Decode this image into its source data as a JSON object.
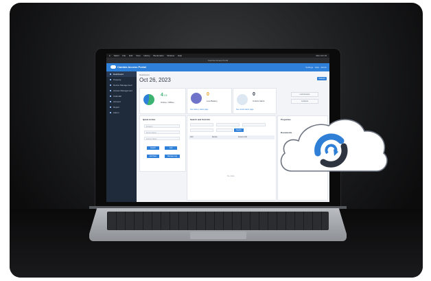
{
  "menubar": {
    "items": [
      "Safari",
      "File",
      "Edit",
      "View",
      "History",
      "Bookmarks",
      "Window",
      "Help"
    ],
    "right": "Mon Oct 16"
  },
  "window": {
    "title": "Cambia Access Portal"
  },
  "app": {
    "brand": "Cambia Access Portal",
    "header_tools": [
      "Settings",
      "Help",
      "Admin"
    ],
    "nav": [
      {
        "label": "Dashboard",
        "active": true
      },
      {
        "label": "Property"
      },
      {
        "label": "Device Management"
      },
      {
        "label": "Access Management"
      },
      {
        "label": "Calendar"
      },
      {
        "label": "Account"
      },
      {
        "label": "Report"
      },
      {
        "label": "Admin"
      }
    ]
  },
  "dashboard": {
    "breadcrumb": "Dashboard",
    "date": "Oct 26, 2023",
    "action_label": "Refresh",
    "stats": [
      {
        "value": "4",
        "secondary": "0",
        "label": "Online / Offline",
        "color": "#3cb371"
      },
      {
        "value": "0",
        "label": "Low Battery",
        "color": "#f0a020",
        "link": "See battery status page"
      },
      {
        "value": "0",
        "label": "Unlock Alerts",
        "color": "#2d3542",
        "link": "See unlock alerts page"
      }
    ],
    "side_pills": [
      "Lock Devices",
      "Lockouts"
    ],
    "quick_action": {
      "title": "Quick Action",
      "fields": [
        "Property",
        "Device Name",
        "Access Name"
      ],
      "buttons": [
        "Search",
        "Add",
        "Add New",
        "Manage Log"
      ]
    },
    "search_unit": {
      "title": "Search and Unit Info",
      "search_button": "Search",
      "columns": [
        "Unit",
        "Device",
        "Access Info"
      ],
      "empty_text": "No data"
    },
    "right_panel": {
      "titles": [
        "Properties",
        "Documents"
      ]
    }
  }
}
